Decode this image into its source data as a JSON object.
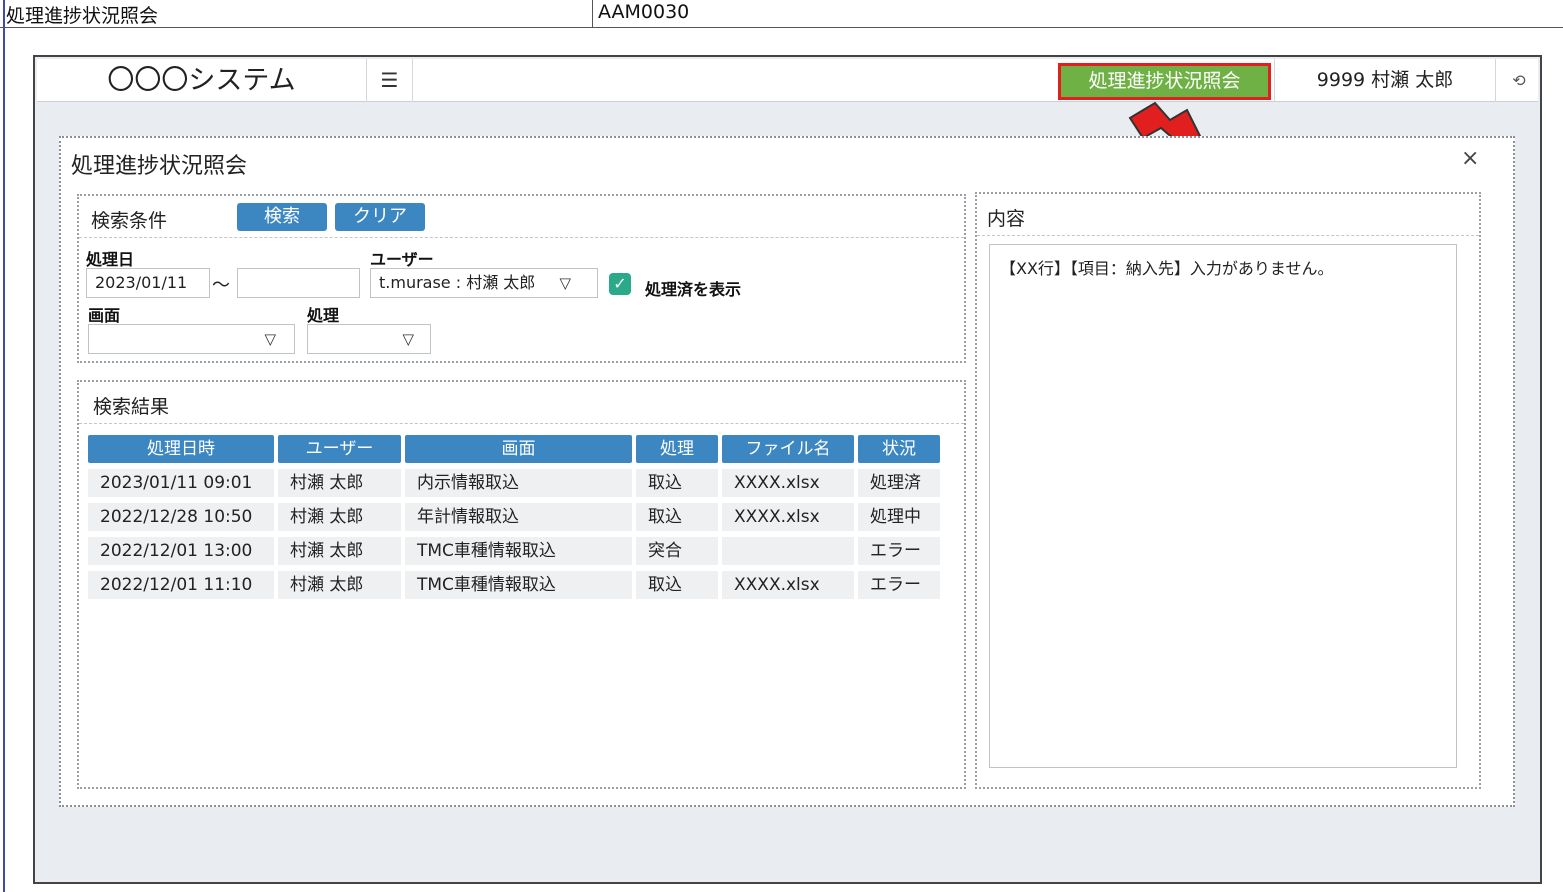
{
  "sheet": {
    "cell_a": "処理進捗状況照会",
    "cell_b": "AAM0030"
  },
  "header": {
    "brand": "〇〇〇システム",
    "menu_icon": "☰",
    "screen_tab": "処理進捗状況照会",
    "user": "9999 村瀬 太郎",
    "logout_icon": "⟲"
  },
  "panel": {
    "title": "処理進捗状況照会",
    "close": "×"
  },
  "search": {
    "title": "検索条件",
    "search_button": "検索",
    "clear_button": "クリア",
    "date_label": "処理日",
    "date_from": "2023/01/11",
    "date_tilde": "～",
    "date_to": "",
    "user_label": "ユーザー",
    "user_value": "t.murase : 村瀬 太郎",
    "show_processed_label": "処理済を表示",
    "screen_label": "画面",
    "screen_value": "",
    "process_label": "処理",
    "process_value": "",
    "caret": "▽",
    "check": "✓"
  },
  "results": {
    "title": "検索結果",
    "columns": [
      "処理日時",
      "ユーザー",
      "画面",
      "処理",
      "ファイル名",
      "状況"
    ],
    "rows": [
      [
        "2023/01/11 09:01",
        "村瀬 太郎",
        "内示情報取込",
        "取込",
        "XXXX.xlsx",
        "処理済"
      ],
      [
        "2022/12/28 10:50",
        "村瀬 太郎",
        "年計情報取込",
        "取込",
        "XXXX.xlsx",
        "処理中"
      ],
      [
        "2022/12/01 13:00",
        "村瀬 太郎",
        "TMC車種情報取込",
        "突合",
        "",
        "エラー"
      ],
      [
        "2022/12/01 11:10",
        "村瀬 太郎",
        "TMC車種情報取込",
        "取込",
        "XXXX.xlsx",
        "エラー"
      ]
    ]
  },
  "detail": {
    "title": "内容",
    "text": "【XX行】【項目：納入先】入力がありません。"
  },
  "colors": {
    "accent": "#3c86c2",
    "tab_green": "#6fb144",
    "highlight_red": "#e21f1f",
    "check_teal": "#2aaa8a"
  }
}
